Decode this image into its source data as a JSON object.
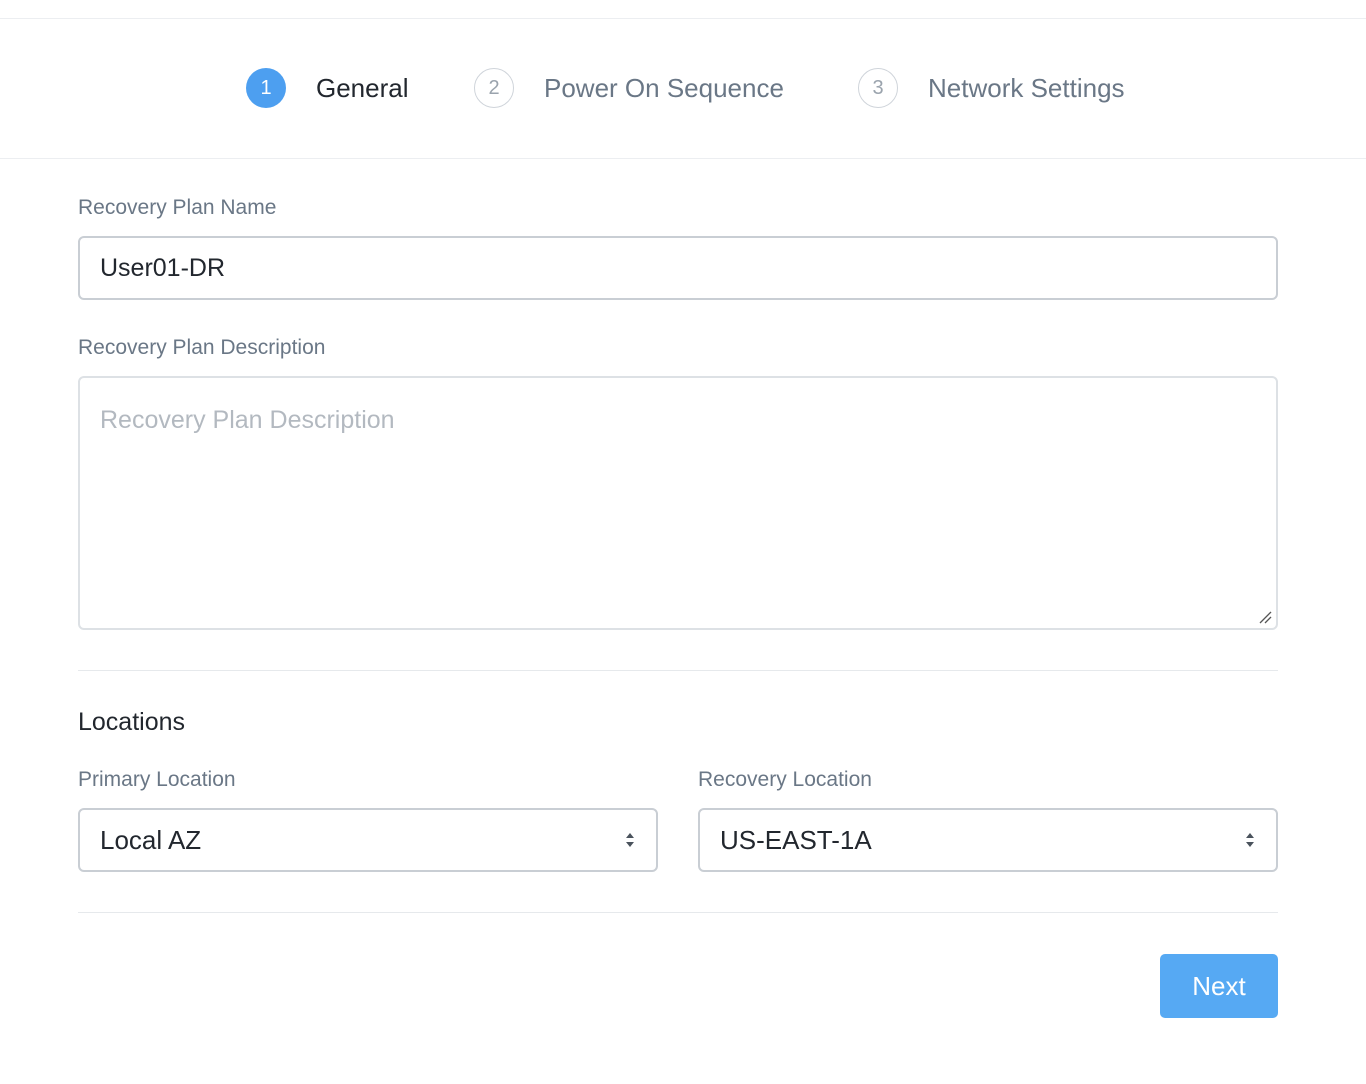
{
  "wizard": {
    "steps": [
      {
        "number": "1",
        "label": "General",
        "state": "active"
      },
      {
        "number": "2",
        "label": "Power On Sequence",
        "state": "inactive"
      },
      {
        "number": "3",
        "label": "Network Settings",
        "state": "inactive"
      }
    ]
  },
  "form": {
    "name_label": "Recovery Plan Name",
    "name_value": "User01-DR",
    "description_label": "Recovery Plan Description",
    "description_placeholder": "Recovery Plan Description",
    "description_value": ""
  },
  "locations": {
    "title": "Locations",
    "primary_label": "Primary Location",
    "primary_value": "Local AZ",
    "recovery_label": "Recovery Location",
    "recovery_value": "US-EAST-1A"
  },
  "footer": {
    "next_label": "Next"
  },
  "colors": {
    "accent": "#4d9ff0",
    "button": "#56a9f3"
  },
  "icons": {
    "select_arrows": "sort-arrows-icon",
    "resize": "resize-handle-icon"
  }
}
